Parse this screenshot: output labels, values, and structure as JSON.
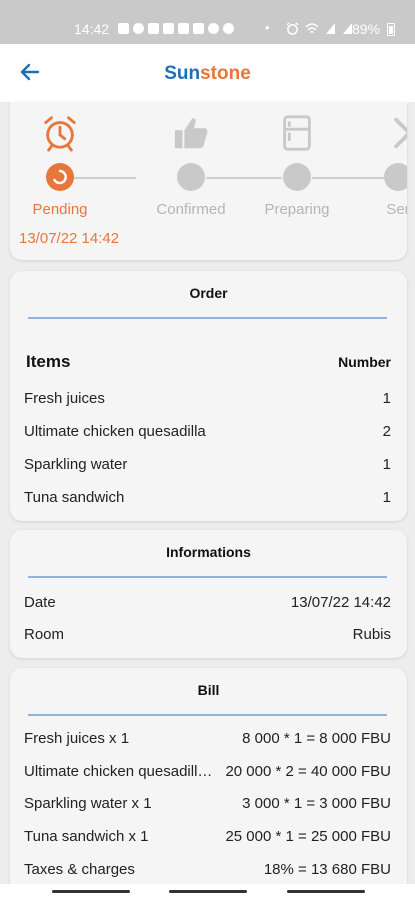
{
  "status_bar": {
    "time": "14:42",
    "notification_icons": [
      "chat-icon",
      "whatsapp-icon",
      "youtube-icon",
      "youtube-icon",
      "youtube-icon",
      "youtube-icon",
      "instagram-icon",
      "instagram-icon"
    ],
    "dot": "•",
    "system_icons": [
      "alarm-icon",
      "wifi-icon",
      "signal-icon",
      "signal-icon"
    ],
    "battery": "89%"
  },
  "app_bar": {
    "back_icon": "back-arrow-icon",
    "brand_part1": "Sun",
    "brand_part2": "stone",
    "colors": {
      "primary": "#1e6fb8",
      "accent": "#e8763a"
    }
  },
  "tracker": {
    "steps": [
      {
        "label": "Pending",
        "icon": "alarm-clock-icon",
        "active": true
      },
      {
        "label": "Confirmed",
        "icon": "thumbs-up-icon",
        "active": false
      },
      {
        "label": "Preparing",
        "icon": "fridge-icon",
        "active": false
      },
      {
        "label": "Ser",
        "icon": "chevron-right-icon",
        "active": false
      }
    ],
    "date": "13/07/22 14:42"
  },
  "order": {
    "title": "Order",
    "items_header": "Items",
    "number_header": "Number",
    "items": [
      {
        "name": "Fresh juices",
        "qty": "1"
      },
      {
        "name": "Ultimate chicken quesadilla",
        "qty": "2"
      },
      {
        "name": "Sparkling water",
        "qty": "1"
      },
      {
        "name": "Tuna sandwich",
        "qty": "1"
      }
    ]
  },
  "informations": {
    "title": "Informations",
    "rows": [
      {
        "label": "Date",
        "value": "13/07/22 14:42"
      },
      {
        "label": "Room",
        "value": "Rubis"
      }
    ]
  },
  "bill": {
    "title": "Bill",
    "rows": [
      {
        "label": "Fresh juices x 1",
        "value": "8 000 * 1 = 8 000 FBU"
      },
      {
        "label": "Ultimate chicken quesadill…",
        "value": "20 000 * 2 = 40 000 FBU"
      },
      {
        "label": "Sparkling water x 1",
        "value": "3 000 * 1 = 3 000 FBU"
      },
      {
        "label": "Tuna sandwich x 1",
        "value": "25 000 * 1 = 25 000 FBU"
      },
      {
        "label": "Taxes & charges",
        "value": "18% = 13 680 FBU"
      }
    ]
  }
}
